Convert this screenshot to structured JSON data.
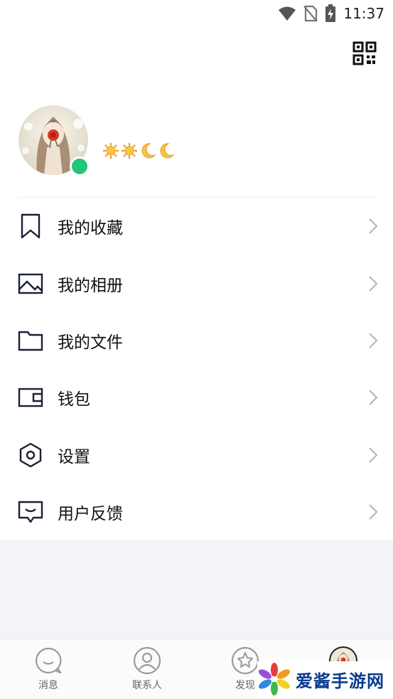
{
  "status_bar": {
    "time": "11:37",
    "icons": [
      "wifi-icon",
      "no-sim-icon",
      "battery-charging-icon"
    ]
  },
  "header": {
    "qr_icon": "qr-code-icon"
  },
  "profile": {
    "avatar": "user-avatar",
    "online_status_color": "#22c67a",
    "level_icons": [
      "sun-icon",
      "sun-icon",
      "moon-icon",
      "moon-icon"
    ]
  },
  "menu": {
    "items": [
      {
        "label": "我的收藏",
        "icon": "bookmark-icon"
      },
      {
        "label": "我的相册",
        "icon": "image-icon"
      },
      {
        "label": "我的文件",
        "icon": "folder-icon"
      },
      {
        "label": "钱包",
        "icon": "wallet-icon"
      },
      {
        "label": "设置",
        "icon": "settings-hex-icon"
      },
      {
        "label": "用户反馈",
        "icon": "feedback-icon"
      }
    ]
  },
  "tab_bar": {
    "tabs": [
      {
        "label": "消息",
        "icon": "chat-bubble-icon"
      },
      {
        "label": "联系人",
        "icon": "contact-person-icon"
      },
      {
        "label": "发现",
        "icon": "discover-star-icon"
      },
      {
        "label": "",
        "icon": "avatar-tab-icon"
      }
    ]
  },
  "watermark": {
    "text": "爱酱手游网"
  },
  "colors": {
    "accent_green": "#22c67a",
    "menu_icon": "#1a1f36",
    "chevron": "#b8b8b8",
    "gray_bg": "#f3f4f8",
    "watermark_blue": "#0a3b8f"
  }
}
